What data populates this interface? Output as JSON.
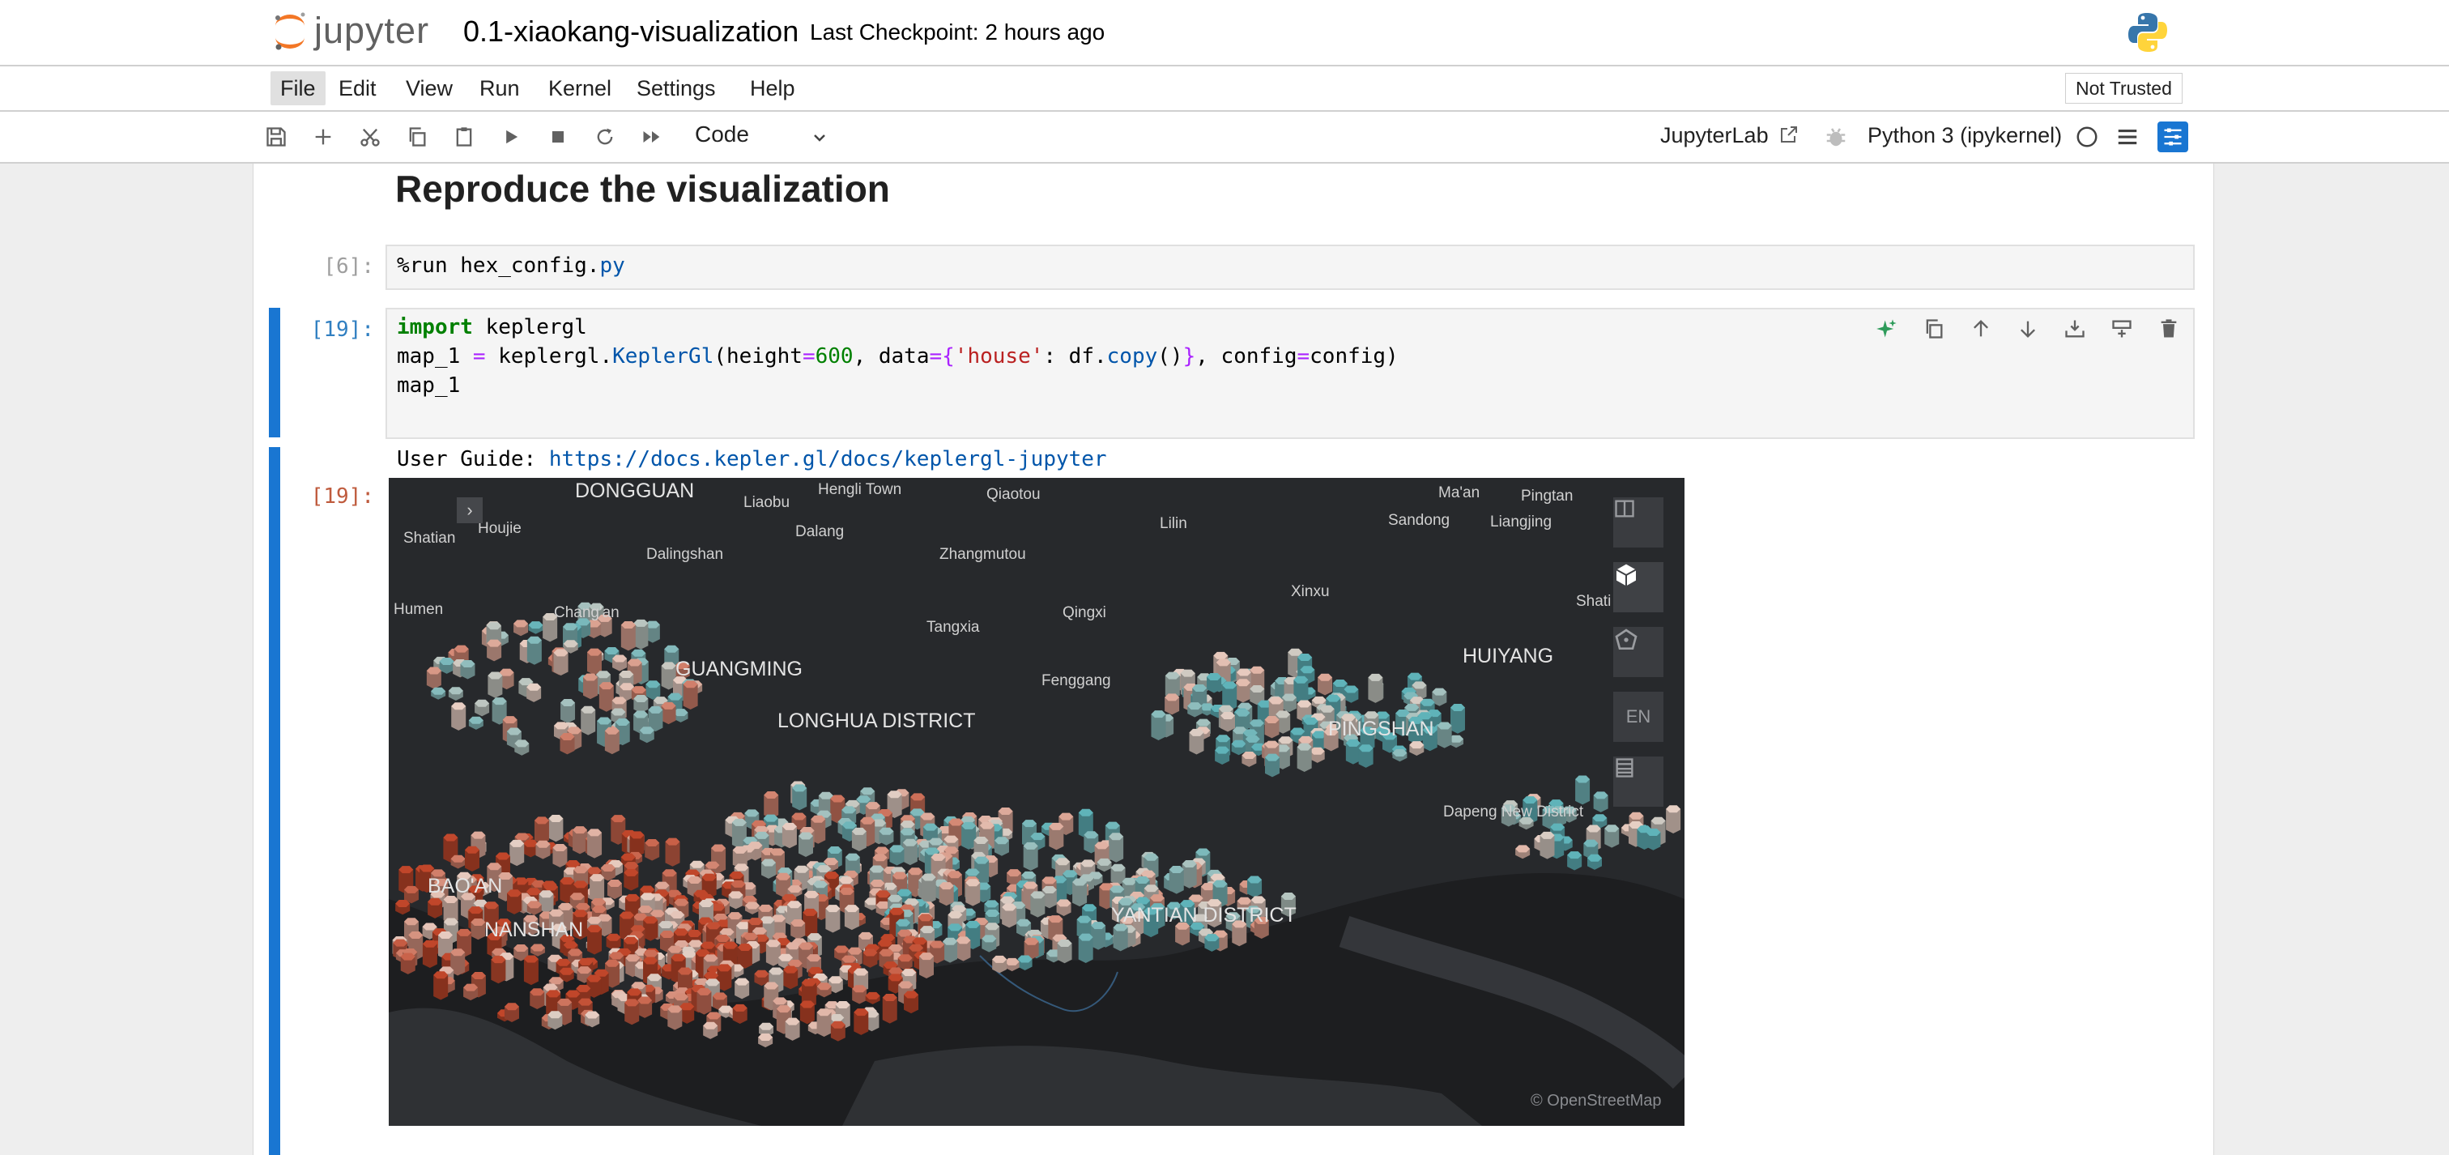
{
  "header": {
    "logo_text": "jupyter",
    "notebook_title": "0.1-xiaokang-visualization",
    "checkpoint": "Last Checkpoint: 2 hours ago"
  },
  "menu": {
    "items": [
      "File",
      "Edit",
      "View",
      "Run",
      "Kernel",
      "Settings",
      "Help"
    ],
    "trust_status": "Not Trusted"
  },
  "toolbar": {
    "cell_type": "Code",
    "jupyterlab_link": "JupyterLab",
    "kernel": "Python 3 (ipykernel)"
  },
  "notebook": {
    "heading": "Reproduce the visualization",
    "cells": [
      {
        "prompt": "[6]:",
        "line1_a": "%run hex_config.",
        "line1_b": "py"
      },
      {
        "prompt": "[19]:",
        "l1_kw": "import",
        "l1_rest": " keplergl",
        "l2_a": "map_1 ",
        "l2_eq": "=",
        "l2_b": " keplergl.",
        "l2_cls": "KeplerGl",
        "l2_c": "(height",
        "l2_eq2": "=",
        "l2_num": "600",
        "l2_d": ", data",
        "l2_eq3": "=",
        "l2_brace1": "{",
        "l2_str": "'house'",
        "l2_e": ": df.",
        "l2_copy": "copy",
        "l2_f": "()",
        "l2_brace2": "}",
        "l2_g": ", config",
        "l2_eq4": "=",
        "l2_h": "config)",
        "l3": "map_1"
      }
    ],
    "output_prompt": "[19]:",
    "user_guide_label": "User Guide: ",
    "user_guide_url": "https://docs.kepler.gl/docs/keplergl-jupyter"
  },
  "map": {
    "labels": [
      {
        "text": "DONGGUAN",
        "big": true
      },
      {
        "text": "Liaobu"
      },
      {
        "text": "Hengli Town"
      },
      {
        "text": "Qiaotou"
      },
      {
        "text": "Ma'an"
      },
      {
        "text": "Pingtan"
      },
      {
        "text": "Shatian"
      },
      {
        "text": "Houjie"
      },
      {
        "text": "Dalang"
      },
      {
        "text": "Lilin"
      },
      {
        "text": "Sandong"
      },
      {
        "text": "Liangjing"
      },
      {
        "text": "Dalingshan"
      },
      {
        "text": "Zhangmutou"
      },
      {
        "text": "Humen"
      },
      {
        "text": "Chang'an"
      },
      {
        "text": "Tangxia"
      },
      {
        "text": "Qingxi"
      },
      {
        "text": "Xinxu"
      },
      {
        "text": "Shati"
      },
      {
        "text": "GUANGMING",
        "big": true
      },
      {
        "text": "Fenggang"
      },
      {
        "text": "HUIYANG",
        "big": true
      },
      {
        "text": "LONGHUA DISTRICT",
        "big": true
      },
      {
        "text": "PINGSHAN",
        "big": true
      },
      {
        "text": "Dapeng New District"
      },
      {
        "text": "BAO'AN",
        "big": true
      },
      {
        "text": "NANSHAN",
        "big": true
      },
      {
        "text": "YANTIAN DISTRICT",
        "big": true
      }
    ],
    "lang_button": "EN",
    "attribution": "© OpenStreetMap",
    "colors": {
      "low": "#5fb3b9",
      "mid": "#e8cfc4",
      "high": "#c0462a"
    }
  }
}
